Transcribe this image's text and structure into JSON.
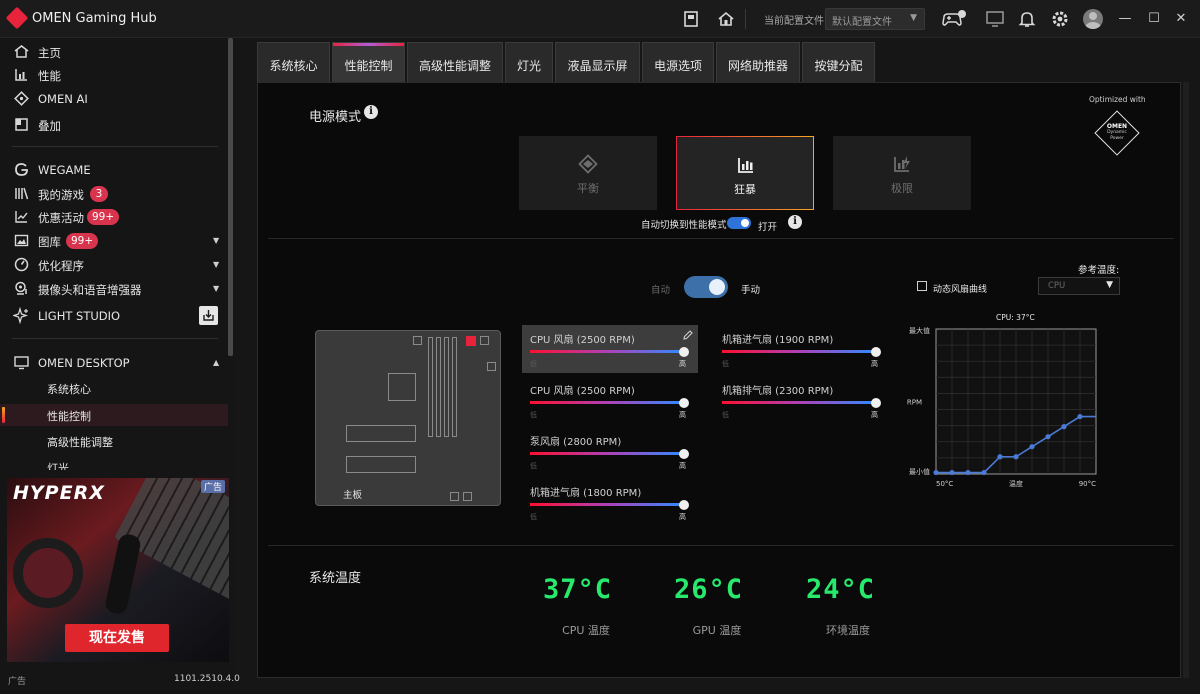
{
  "app": {
    "title": "OMEN Gaming Hub"
  },
  "titlebar": {
    "profile_label": "当前配置文件",
    "profile_value": "默认配置文件"
  },
  "sidebar": {
    "items": [
      {
        "label": "主页",
        "icon": "home-icon"
      },
      {
        "label": "性能",
        "icon": "performance-icon"
      },
      {
        "label": "OMEN AI",
        "icon": "omen-ai-icon"
      },
      {
        "label": "叠加",
        "icon": "overlay-icon"
      },
      {
        "label": "WEGAME",
        "icon": "wegame-icon"
      },
      {
        "label": "我的游戏",
        "icon": "library-icon",
        "badge": "3"
      },
      {
        "label": "优惠活动",
        "icon": "chart-line-icon",
        "badge": "99+"
      },
      {
        "label": "图库",
        "icon": "gallery-icon",
        "badge": "99+"
      },
      {
        "label": "优化程序",
        "icon": "gauge-icon"
      },
      {
        "label": "摄像头和语音增强器",
        "icon": "webcam-icon"
      },
      {
        "label": "LIGHT STUDIO",
        "icon": "sparkle-icon"
      },
      {
        "label": "OMEN DESKTOP",
        "icon": "desktop-icon"
      }
    ],
    "subitems": [
      "系统核心",
      "性能控制",
      "高级性能调整",
      "灯光"
    ],
    "active_subitem": 1,
    "ad": {
      "brand": "HYPERX",
      "ad_icon": "广告",
      "cta": "现在发售"
    },
    "ad_label": "广告",
    "version": "1101.2510.4.0"
  },
  "tabs": [
    "系统核心",
    "性能控制",
    "高级性能调整",
    "灯光",
    "液晶显示屏",
    "电源选项",
    "网络助推器",
    "按键分配"
  ],
  "active_tab": 1,
  "power": {
    "title": "电源模式",
    "optimized_with": "Optimized with",
    "omen_badge": {
      "brand": "OMEN",
      "line1": "Dynamic",
      "line2": "Power"
    },
    "modes": [
      {
        "label": "平衡",
        "icon": "balanced-icon"
      },
      {
        "label": "狂暴",
        "icon": "performance-bars-icon",
        "active": true
      },
      {
        "label": "极限",
        "icon": "extreme-icon"
      }
    ],
    "auto_switch_label": "自动切换到性能模式",
    "auto_switch_state": "打开"
  },
  "fan_control": {
    "auto_label": "自动",
    "manual_label": "手动",
    "dynamic_curve_label": "动态风扇曲线",
    "ref_temp_label": "参考温度:",
    "ref_temp_value": "CPU",
    "motherboard_label": "主板",
    "low_label": "低",
    "high_label": "高",
    "fans": [
      {
        "name": "CPU 风扇 (2500 RPM)",
        "level": 1.0
      },
      {
        "name": "CPU 风扇 (2500 RPM)",
        "level": 1.0
      },
      {
        "name": "泵风扇 (2800 RPM)",
        "level": 1.0
      },
      {
        "name": "机箱进气扇 (1800 RPM)",
        "level": 1.0
      },
      {
        "name": "机箱进气扇 (1900 RPM)",
        "level": 1.0
      },
      {
        "name": "机箱排气扇 (2300 RPM)",
        "level": 1.0
      }
    ]
  },
  "chart_data": {
    "type": "line",
    "title": "CPU: 37°C",
    "xlabel": "温度",
    "ylabel": "RPM",
    "x_tick_labels": [
      "50°C",
      "90°C"
    ],
    "y_tick_labels": [
      "最大值",
      "最小值"
    ],
    "xlim": [
      50,
      90
    ],
    "ylim": [
      0,
      1
    ],
    "grid": true,
    "series": [
      {
        "x": [
          50,
          54,
          58,
          62,
          66,
          70,
          74,
          78,
          82,
          86,
          90
        ],
        "y": [
          0.0,
          0.0,
          0.0,
          0.0,
          0.11,
          0.11,
          0.18,
          0.25,
          0.32,
          0.39,
          0.39
        ]
      }
    ],
    "color": "#4a7bd6"
  },
  "system_temps": {
    "title": "系统温度",
    "items": [
      {
        "value": "37°C",
        "label": "CPU 温度"
      },
      {
        "value": "26°C",
        "label": "GPU 温度"
      },
      {
        "value": "24°C",
        "label": "环境温度"
      }
    ]
  }
}
